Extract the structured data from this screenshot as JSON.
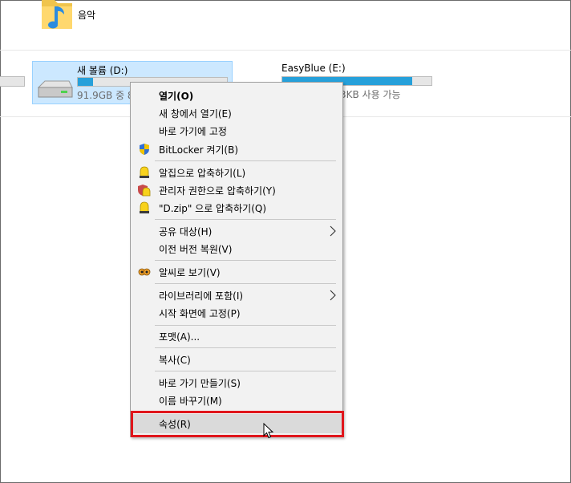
{
  "music_folder": {
    "label": "음악",
    "icon": "music-folder-icon"
  },
  "drives": [
    {
      "name": "새 볼륨 (D:)",
      "info": "91.9GB 중 8",
      "used_fraction": 0.1,
      "selected": true
    },
    {
      "name": "EasyBlue (E:)",
      "info": "3KB 사용 가능",
      "used_fraction": 0.87,
      "selected": false
    }
  ],
  "context_menu": {
    "groups": [
      [
        {
          "label": "열기(O)",
          "bold": true
        },
        {
          "label": "새 창에서 열기(E)"
        },
        {
          "label": "바로 가기에 고정"
        },
        {
          "label": "BitLocker 켜기(B)",
          "icon": "shield-icon"
        }
      ],
      [
        {
          "label": "알집으로 압축하기(L)",
          "icon": "alzip-icon"
        },
        {
          "label": "관리자 권한으로 압축하기(Y)",
          "icon": "admin-shield-alzip-icon"
        },
        {
          "label": "\"D.zip\" 으로 압축하기(Q)",
          "icon": "alzip-icon"
        }
      ],
      [
        {
          "label": "공유 대상(H)",
          "submenu": true
        },
        {
          "label": "이전 버전 복원(V)"
        }
      ],
      [
        {
          "label": "알씨로 보기(V)",
          "icon": "alsee-icon"
        }
      ],
      [
        {
          "label": "라이브러리에 포함(I)",
          "submenu": true
        },
        {
          "label": "시작 화면에 고정(P)"
        }
      ],
      [
        {
          "label": "포맷(A)..."
        }
      ],
      [
        {
          "label": "복사(C)"
        }
      ],
      [
        {
          "label": "바로 가기 만들기(S)"
        },
        {
          "label": "이름 바꾸기(M)"
        }
      ],
      [
        {
          "label": "속성(R)",
          "hovered": true
        }
      ]
    ]
  },
  "colors": {
    "accent": "#26a0da",
    "selection_bg": "#cce8ff",
    "highlight_border": "#e0161c"
  }
}
